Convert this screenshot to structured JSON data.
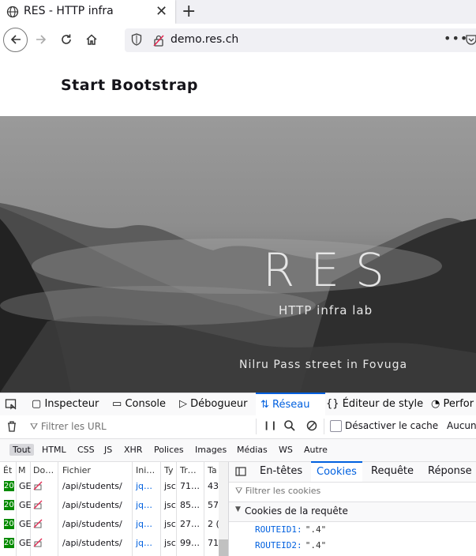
{
  "browser": {
    "tab_title": "RES - HTTP infra",
    "url": "demo.res.ch",
    "menu_dots": "•••"
  },
  "page": {
    "brand": "Start Bootstrap",
    "hero_title": "RES",
    "hero_subtitle": "HTTP infra lab",
    "hero_caption": "Nilru Pass street in Fovuga"
  },
  "devtools": {
    "tabs": [
      "Inspecteur",
      "Console",
      "Débogueur",
      "Réseau",
      "Éditeur de style",
      "Perfor"
    ],
    "filter_placeholder": "Filtrer les URL",
    "pause_glyph": "❙❙",
    "disable_cache_label": "Désactiver le cache",
    "throttle_label": "Aucun",
    "type_filters": [
      "Tout",
      "HTML",
      "CSS",
      "JS",
      "XHR",
      "Polices",
      "Images",
      "Médias",
      "WS",
      "Autre"
    ],
    "columns": [
      "Ét",
      "M",
      "Do…",
      "Fichier",
      "Ini…",
      "Ty",
      "Tr…",
      "Ta"
    ],
    "rows": [
      {
        "status": "20",
        "method": "GE",
        "file": "/api/students/",
        "initiator": "jq…",
        "type": "jsc",
        "transferred": "71…",
        "size": "43"
      },
      {
        "status": "20",
        "method": "GE",
        "file": "/api/students/",
        "initiator": "jq…",
        "type": "jsc",
        "transferred": "85…",
        "size": "57"
      },
      {
        "status": "20",
        "method": "GE",
        "file": "/api/students/",
        "initiator": "jq…",
        "type": "jsc",
        "transferred": "27…",
        "size": "2 ("
      },
      {
        "status": "20",
        "method": "GE",
        "file": "/api/students/",
        "initiator": "jq…",
        "type": "jsc",
        "transferred": "99…",
        "size": "71"
      }
    ],
    "side_tabs": [
      "En-têtes",
      "Cookies",
      "Requête",
      "Réponse"
    ],
    "cookie_filter_placeholder": "Filtrer les cookies",
    "cookies_section": "Cookies de la requête",
    "cookies": [
      {
        "name": "ROUTEID1:",
        "value": "\".4\""
      },
      {
        "name": "ROUTEID2:",
        "value": "\".4\""
      }
    ]
  }
}
